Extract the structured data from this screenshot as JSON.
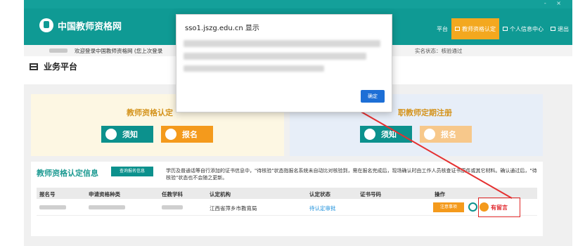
{
  "header": {
    "site_name": "中国教师资格网",
    "window_controls": "- ×",
    "nav": [
      {
        "label": "平台"
      },
      {
        "label": "教师资格认定"
      },
      {
        "label": "个人信息中心"
      },
      {
        "label": "退出"
      }
    ],
    "accent_color": "#0f9a94",
    "active_nav_color": "#f3a81f"
  },
  "welcome": {
    "text": "欢迎登录中国教师资格网 (您上次登录",
    "status": "实名状态：核验通过"
  },
  "page_title": "业务平台",
  "cards": {
    "left": {
      "title": "教师资格认定",
      "btn_notice": "须知",
      "btn_apply": "报名"
    },
    "right": {
      "title": "职教师定期注册",
      "btn_notice": "须知",
      "btn_apply": "报名"
    }
  },
  "info": {
    "title": "教师资格认定信息",
    "query_button": "查询报名信息",
    "notice": "学历及普通话等自行添加的证书信息中，\"待核验\"状态指报名系统未自动比对核验到，需在报名完成后，现场确认时由工作人员核查证书原件或其它材料。确认通过后，\"待核验\"状态也不会随之更新。"
  },
  "table": {
    "columns": [
      "报名号",
      "申请资格种类",
      "任教学科",
      "认定机构",
      "认定状态",
      "证书号码",
      "操作"
    ],
    "rows": [
      {
        "agency": "江西省萍乡市教育局",
        "status": "待认定审批",
        "note_button": "注意事项",
        "message_link": "有留言"
      }
    ]
  },
  "dialog": {
    "title": "sso1.jszg.edu.cn 显示",
    "ok": "确定"
  }
}
